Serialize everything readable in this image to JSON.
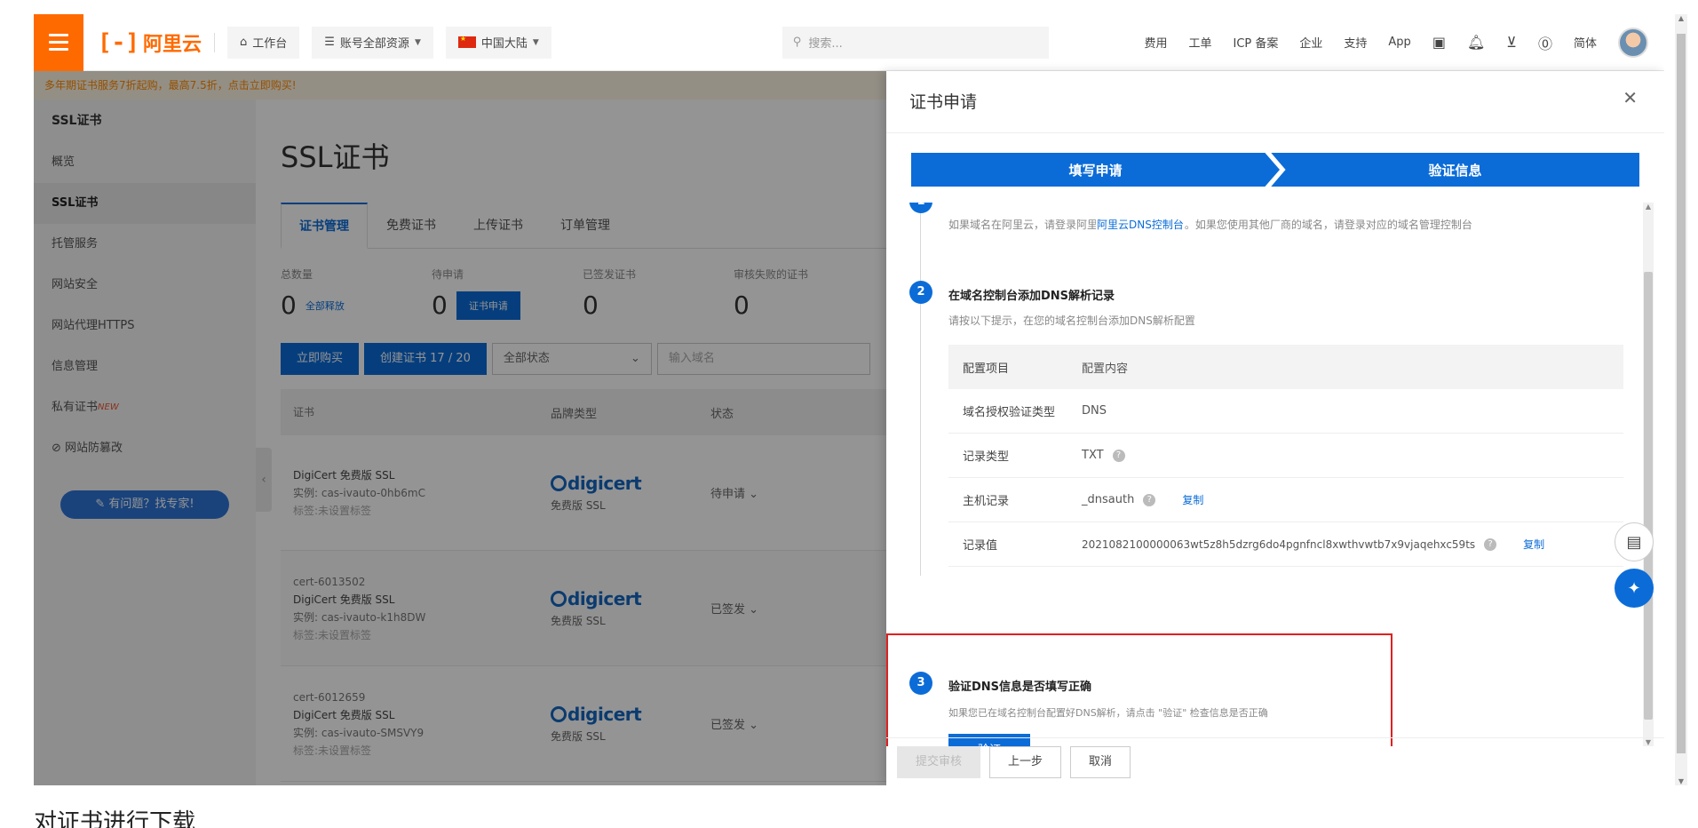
{
  "topbar": {
    "logo_text": "阿里云",
    "workbench": "工作台",
    "account_resources": "账号全部资源",
    "region": "中国大陆",
    "search_placeholder": "搜索...",
    "links": [
      "费用",
      "工单",
      "ICP 备案",
      "企业",
      "支持",
      "App"
    ],
    "lang": "简体"
  },
  "banner": {
    "text": "多年期证书服务7折起购，最高7.5折，点击立即购买!"
  },
  "sidebar": {
    "title": "SSL证书",
    "items": [
      {
        "label": "概览"
      },
      {
        "label": "SSL证书"
      },
      {
        "label": "托管服务"
      },
      {
        "label": "网站安全"
      },
      {
        "label": "网站代理HTTPS"
      },
      {
        "label": "信息管理"
      },
      {
        "label": "私有证书"
      },
      {
        "label": "网站防篡改"
      }
    ],
    "new_badge": "NEW",
    "ask_button": "有问题？找专家!"
  },
  "content": {
    "title": "SSL证书",
    "tabs": [
      "证书管理",
      "免费证书",
      "上传证书",
      "订单管理"
    ],
    "stats": [
      {
        "label": "总数量",
        "value": "0",
        "extra": "全部释放"
      },
      {
        "label": "待申请",
        "value": "0",
        "extra": "证书申请"
      },
      {
        "label": "已签发证书",
        "value": "0"
      },
      {
        "label": "审核失败的证书",
        "value": "0"
      }
    ],
    "actions": {
      "buy": "立即购买",
      "create": "创建证书 17 / 20",
      "status_select": "全部状态",
      "domain_placeholder": "输入域名"
    },
    "table_headers": [
      "证书",
      "品牌类型",
      "状态"
    ],
    "rows": [
      {
        "line1": "DigiCert 免费版 SSL",
        "line2": "实例: cas-ivauto-0hb6mC",
        "line3": "标签:未设置标签",
        "brand_sub": "免费版 SSL",
        "status": "待申请"
      },
      {
        "line0": "cert-6013502",
        "line1": "DigiCert 免费版 SSL",
        "line2": "实例: cas-ivauto-k1h8DW",
        "line3": "标签:未设置标签",
        "brand_sub": "免费版 SSL",
        "status": "已签发"
      },
      {
        "line0": "cert-6012659",
        "line1": "DigiCert 免费版 SSL",
        "line2": "实例: cas-ivauto-SMSVY9",
        "line3": "标签:未设置标签",
        "brand_sub": "免费版 SSL",
        "status": "已签发"
      }
    ],
    "brand": "digicert"
  },
  "drawer": {
    "title": "证书申请",
    "steps": [
      "填写申请",
      "验证信息"
    ],
    "step1_desc": "如果域名在阿里云，请登录阿里云DNS控制台操作。如果您使用其他厂商的域名，请登录对应的域名管理控制台",
    "step1_link": "阿里云DNS控制台",
    "step2_title": "在域名控制台添加DNS解析记录",
    "step2_desc": "请按以下提示，在您的域名控制台添加DNS解析配置",
    "dns_header": [
      "配置项目",
      "配置内容"
    ],
    "dns_rows": [
      {
        "key": "域名授权验证类型",
        "value": "DNS"
      },
      {
        "key": "记录类型",
        "value": "TXT"
      },
      {
        "key": "主机记录",
        "value": "_dnsauth"
      },
      {
        "key": "记录值",
        "value": "2021082100000063wt5z8h5dzrg6do4pgnfncl8xwthvwtb7x9vjaqehxc59ts"
      }
    ],
    "copy": "复制",
    "step3_title": "验证DNS信息是否填写正确",
    "step3_desc": "如果您已在域名控制台配置好DNS解析，请点击 \"验证\" 检查信息是否正确",
    "verify": "验证",
    "footer": {
      "submit": "提交审核",
      "prev": "上一步",
      "cancel": "取消"
    }
  },
  "caption": "对证书进行下载"
}
